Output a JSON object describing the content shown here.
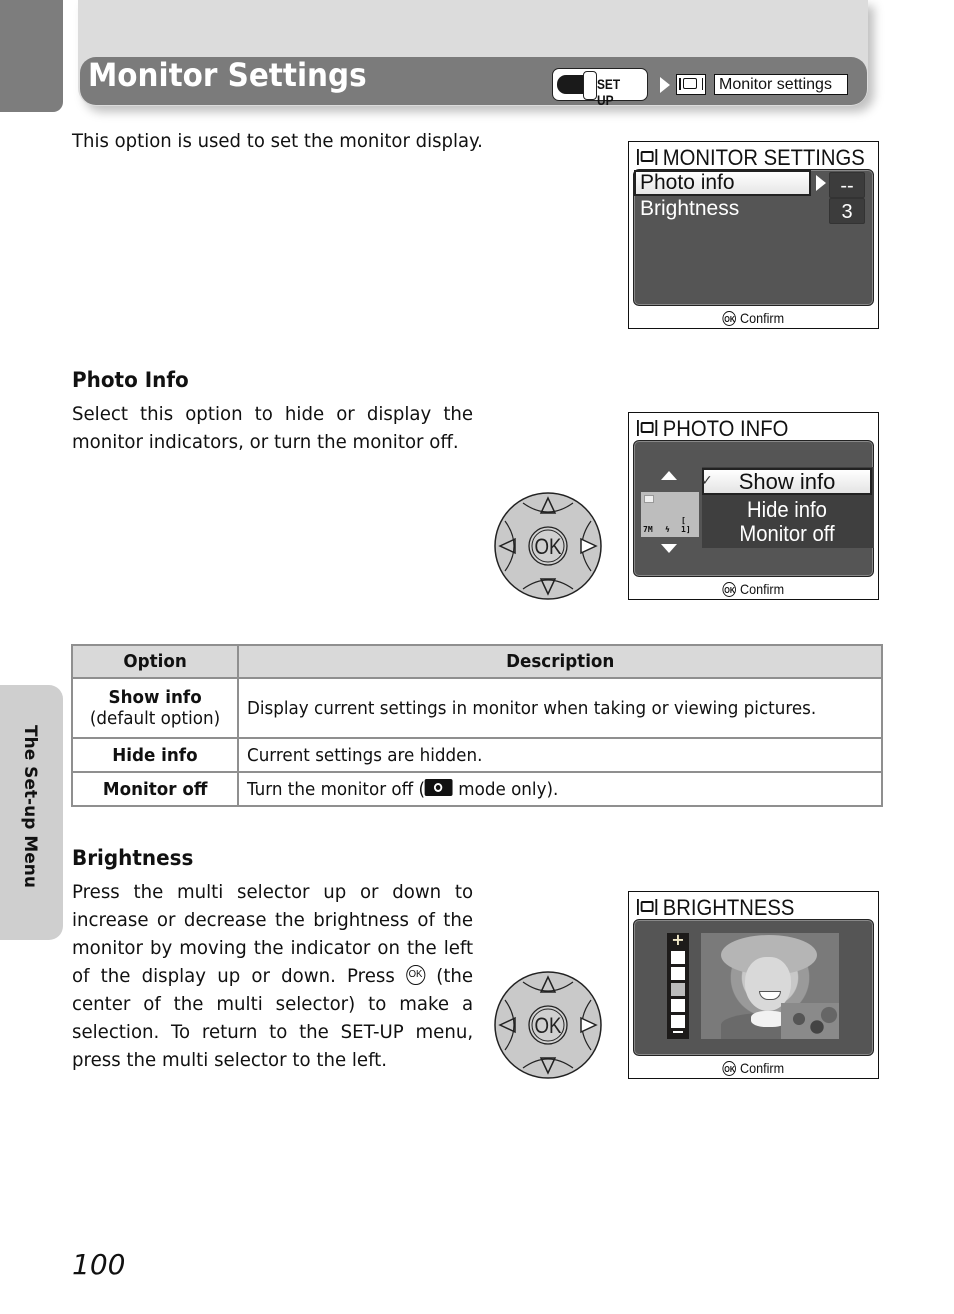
{
  "header": {
    "title": "Monitor Settings",
    "breadcrumb": {
      "mode_dial_label": "SET UP",
      "menu_icon": "monitor-icon",
      "menu_item": "Monitor settings"
    }
  },
  "intro": "This option is used to set the monitor display.",
  "screens": {
    "monitor_settings": {
      "title": "MONITOR SETTINGS",
      "items": [
        {
          "label": "Photo info",
          "value": "--",
          "selected": true
        },
        {
          "label": "Brightness",
          "value": "3",
          "selected": false
        }
      ],
      "footer_icon": "OK",
      "footer": "Confirm"
    },
    "photo_info": {
      "title": "PHOTO INFO",
      "options": [
        {
          "label": "Show info",
          "selected": true,
          "checked": true
        },
        {
          "label": "Hide info",
          "selected": false
        },
        {
          "label": "Monitor off",
          "selected": false
        }
      ],
      "preview_indicators": [
        "7M",
        "flash",
        "[ 1]"
      ],
      "footer_icon": "OK",
      "footer": "Confirm"
    },
    "brightness": {
      "title": "BRIGHTNESS",
      "scale_plus": "+",
      "scale_minus": "−",
      "levels": 5,
      "current_level": 3,
      "footer_icon": "OK",
      "footer": "Confirm"
    }
  },
  "photo_info_section": {
    "heading": "Photo Info",
    "body": "Select this option to hide or display the monitor indicators, or turn the monitor off."
  },
  "multi_selector": {
    "center_label": "OK",
    "highlight": "right"
  },
  "table": {
    "headers": [
      "Option",
      "Description"
    ],
    "rows": [
      {
        "option": "Show info",
        "note": "(default option)",
        "description": "Display current settings in monitor when taking or viewing pictures."
      },
      {
        "option": "Hide info",
        "note": "",
        "description": "Current settings are hidden."
      },
      {
        "option": "Monitor off",
        "note": "",
        "description_before": "Turn the monitor off (",
        "description_icon": "camera-mode-icon",
        "description_after": " mode only)."
      }
    ]
  },
  "brightness_section": {
    "heading": "Brightness",
    "body_before": "Press the multi selector up or down to increase or decrease the brightness of the monitor by moving the indicator on the left of the display up or down. Press ",
    "body_icon": "OK",
    "body_after": " (the center of the multi selector) to make a selection. To return to the SET-UP menu, press the multi selector to the left."
  },
  "side_tab": "The Set-up Menu",
  "page_number": "100"
}
